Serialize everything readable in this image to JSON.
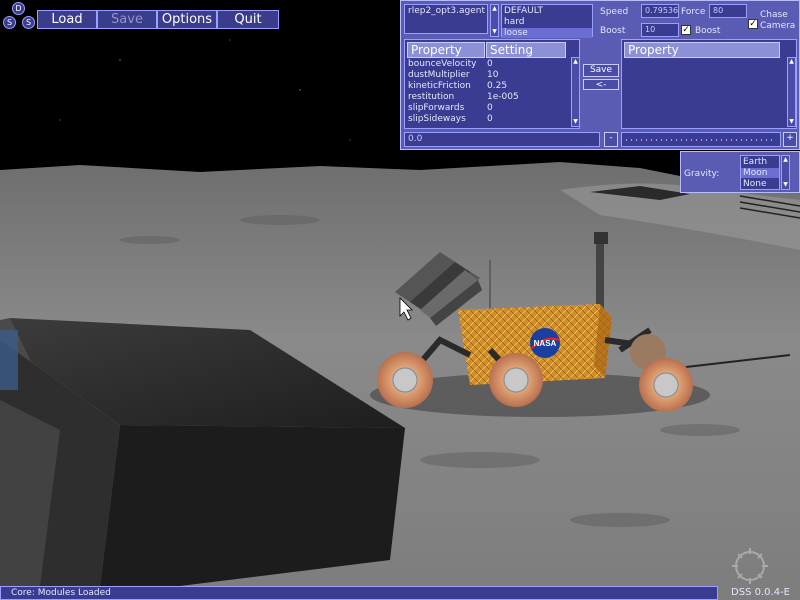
{
  "menu": {
    "logo_letters": [
      "D",
      "S",
      "S"
    ],
    "buttons": [
      {
        "label": "Load",
        "enabled": true
      },
      {
        "label": "Save",
        "enabled": false
      },
      {
        "label": "Options",
        "enabled": true
      },
      {
        "label": "Quit",
        "enabled": true
      }
    ]
  },
  "agent_panel": {
    "agent_file": "rlep2_opt3.agent",
    "profiles": [
      "DEFAULT",
      "hard",
      "loose"
    ],
    "selected_profile": "loose",
    "speed_label": "Speed",
    "speed_value": "0.79536",
    "force_label": "Force",
    "force_value": "80",
    "boost_label": "Boost",
    "boost_value": "10",
    "boost_check_label": "Boost",
    "boost_checked": true,
    "chase_camera_label": "Chase Camera",
    "chase_camera_checked": true,
    "left_table": {
      "headers": [
        "Property",
        "Setting"
      ],
      "rows": [
        [
          "bounceVelocity",
          "0"
        ],
        [
          "dustMultiplier",
          "10"
        ],
        [
          "kineticFriction",
          "0.25"
        ],
        [
          "restitution",
          "1e-005"
        ],
        [
          "slipForwards",
          "0"
        ],
        [
          "slipSideways",
          "0"
        ]
      ]
    },
    "save_button": "Save",
    "back_button": "<-",
    "right_table_header": "Property",
    "value_field": "0.0",
    "minus_button": "-",
    "plus_button": "+"
  },
  "gravity_panel": {
    "label": "Gravity:",
    "options": [
      "Earth",
      "Moon",
      "None"
    ],
    "selected": "Moon"
  },
  "status_bar": {
    "message": "Core: Modules Loaded",
    "version": "DSS 0.0.4-E"
  },
  "colors": {
    "panel": "#5a5cb4",
    "panel_inner": "#3a3c92",
    "border": "#b8bcff",
    "sky": "#000000",
    "ground": "#7a7a7a",
    "rover_body": "#d89a2a"
  },
  "icons": {
    "cursor": "arrow-cursor-icon",
    "gear_logo": "gear-logo-icon",
    "nasa": "nasa-logo-icon"
  }
}
